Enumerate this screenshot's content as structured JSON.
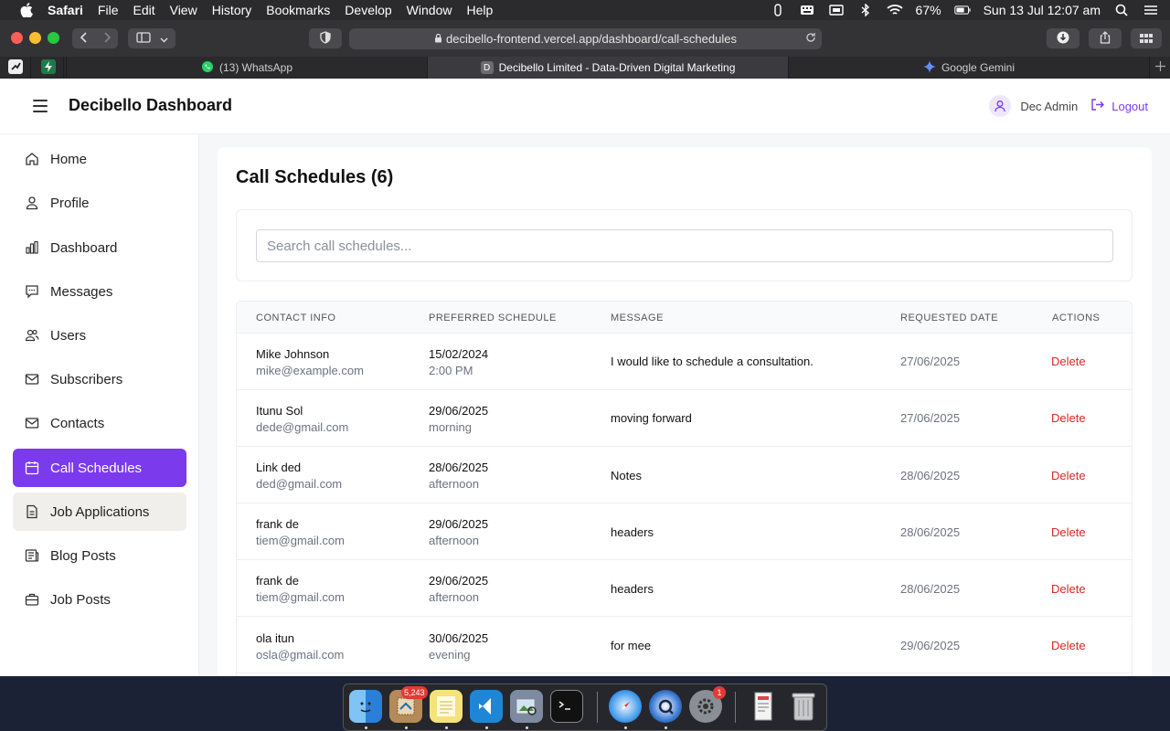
{
  "menubar": {
    "app_name": "Safari",
    "items": [
      "File",
      "Edit",
      "View",
      "History",
      "Bookmarks",
      "Develop",
      "Window",
      "Help"
    ],
    "battery": "67%",
    "datetime": "Sun 13 Jul  12:07 am"
  },
  "browser": {
    "url": "decibello-frontend.vercel.app/dashboard/call-schedules",
    "tabs": [
      {
        "label": "(13) WhatsApp",
        "icon": "whatsapp-icon"
      },
      {
        "label": "Decibello Limited - Data-Driven Digital Marketing",
        "icon": "decibello-favicon",
        "favicon_letter": "D"
      },
      {
        "label": "Google Gemini",
        "icon": "gemini-icon"
      }
    ]
  },
  "header": {
    "title": "Decibello Dashboard",
    "user_name": "Dec Admin",
    "logout_label": "Logout"
  },
  "sidebar": {
    "items": [
      {
        "label": "Home",
        "icon": "home-icon"
      },
      {
        "label": "Profile",
        "icon": "user-icon"
      },
      {
        "label": "Dashboard",
        "icon": "bar-chart-icon"
      },
      {
        "label": "Messages",
        "icon": "message-icon"
      },
      {
        "label": "Users",
        "icon": "users-icon"
      },
      {
        "label": "Subscribers",
        "icon": "mail-icon"
      },
      {
        "label": "Contacts",
        "icon": "mail-icon"
      },
      {
        "label": "Call Schedules",
        "icon": "calendar-icon"
      },
      {
        "label": "Job Applications",
        "icon": "document-icon"
      },
      {
        "label": "Blog Posts",
        "icon": "newspaper-icon"
      },
      {
        "label": "Job Posts",
        "icon": "briefcase-icon"
      }
    ],
    "active": "Call Schedules"
  },
  "main": {
    "title": "Call Schedules (6)",
    "search_placeholder": "Search call schedules...",
    "columns": [
      "CONTACT INFO",
      "PREFERRED SCHEDULE",
      "MESSAGE",
      "REQUESTED DATE",
      "ACTIONS"
    ],
    "rows": [
      {
        "name": "Mike Johnson",
        "email": "mike@example.com",
        "date": "15/02/2024",
        "time": "2:00 PM",
        "message": "I would like to schedule a consultation.",
        "requested": "27/06/2025",
        "action": "Delete"
      },
      {
        "name": "Itunu Sol",
        "email": "dede@gmail.com",
        "date": "29/06/2025",
        "time": "morning",
        "message": "moving forward",
        "requested": "27/06/2025",
        "action": "Delete"
      },
      {
        "name": "Link ded",
        "email": "ded@gmail.com",
        "date": "28/06/2025",
        "time": "afternoon",
        "message": "Notes",
        "requested": "28/06/2025",
        "action": "Delete"
      },
      {
        "name": "frank de",
        "email": "tiem@gmail.com",
        "date": "29/06/2025",
        "time": "afternoon",
        "message": "headers",
        "requested": "28/06/2025",
        "action": "Delete"
      },
      {
        "name": "frank de",
        "email": "tiem@gmail.com",
        "date": "29/06/2025",
        "time": "afternoon",
        "message": "headers",
        "requested": "28/06/2025",
        "action": "Delete"
      },
      {
        "name": "ola itun",
        "email": "osla@gmail.com",
        "date": "30/06/2025",
        "time": "evening",
        "message": "for mee",
        "requested": "29/06/2025",
        "action": "Delete"
      }
    ]
  },
  "dock": {
    "mail_badge": "5,243",
    "settings_badge": "1"
  },
  "colors": {
    "accent": "#7c3aed",
    "danger": "#dc2626",
    "hover": "#f0efec"
  }
}
